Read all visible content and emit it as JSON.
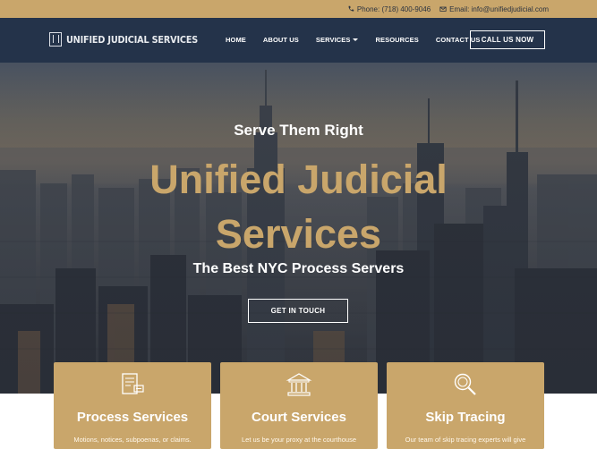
{
  "topbar": {
    "phone": "Phone: (718) 400-9046",
    "email": "Email: info@unifiedjudicial.com",
    "phone_icon": "phone-icon",
    "email_icon": "envelope-icon"
  },
  "nav": {
    "logo_text": "UNIFIED JUDICIAL SERVICES",
    "items": [
      {
        "label": "HOME"
      },
      {
        "label": "ABOUT US"
      },
      {
        "label": "SERVICES"
      },
      {
        "label": "RESOURCES"
      },
      {
        "label": "CONTACT US"
      }
    ],
    "cta_label": "CALL US NOW"
  },
  "hero": {
    "subtitle": "Serve Them Right",
    "title_line1": "Unified Judicial",
    "title_line2": "Services",
    "tagline": "The Best NYC Process Servers",
    "button_label": "GET IN TOUCH"
  },
  "cards": [
    {
      "title": "Process Services",
      "desc": "Motions, notices, subpoenas, or claims.",
      "icon": "document-stamp-icon"
    },
    {
      "title": "Court Services",
      "desc": "Let us be your proxy at the courthouse",
      "icon": "courthouse-icon"
    },
    {
      "title": "Skip Tracing",
      "desc": "Our team of skip tracing experts will give",
      "icon": "magnifier-icon"
    }
  ],
  "colors": {
    "gold": "#c9a66b",
    "navy": "#24334a"
  }
}
